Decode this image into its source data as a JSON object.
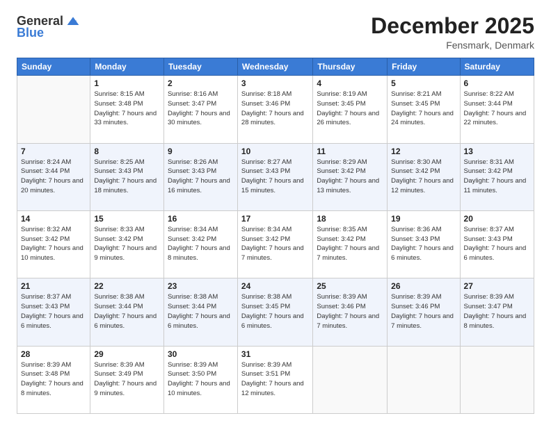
{
  "logo": {
    "general": "General",
    "blue": "Blue"
  },
  "header": {
    "month": "December 2025",
    "location": "Fensmark, Denmark"
  },
  "weekdays": [
    "Sunday",
    "Monday",
    "Tuesday",
    "Wednesday",
    "Thursday",
    "Friday",
    "Saturday"
  ],
  "weeks": [
    [
      {
        "day": "",
        "sunrise": "",
        "sunset": "",
        "daylight": ""
      },
      {
        "day": "1",
        "sunrise": "Sunrise: 8:15 AM",
        "sunset": "Sunset: 3:48 PM",
        "daylight": "Daylight: 7 hours and 33 minutes."
      },
      {
        "day": "2",
        "sunrise": "Sunrise: 8:16 AM",
        "sunset": "Sunset: 3:47 PM",
        "daylight": "Daylight: 7 hours and 30 minutes."
      },
      {
        "day": "3",
        "sunrise": "Sunrise: 8:18 AM",
        "sunset": "Sunset: 3:46 PM",
        "daylight": "Daylight: 7 hours and 28 minutes."
      },
      {
        "day": "4",
        "sunrise": "Sunrise: 8:19 AM",
        "sunset": "Sunset: 3:45 PM",
        "daylight": "Daylight: 7 hours and 26 minutes."
      },
      {
        "day": "5",
        "sunrise": "Sunrise: 8:21 AM",
        "sunset": "Sunset: 3:45 PM",
        "daylight": "Daylight: 7 hours and 24 minutes."
      },
      {
        "day": "6",
        "sunrise": "Sunrise: 8:22 AM",
        "sunset": "Sunset: 3:44 PM",
        "daylight": "Daylight: 7 hours and 22 minutes."
      }
    ],
    [
      {
        "day": "7",
        "sunrise": "Sunrise: 8:24 AM",
        "sunset": "Sunset: 3:44 PM",
        "daylight": "Daylight: 7 hours and 20 minutes."
      },
      {
        "day": "8",
        "sunrise": "Sunrise: 8:25 AM",
        "sunset": "Sunset: 3:43 PM",
        "daylight": "Daylight: 7 hours and 18 minutes."
      },
      {
        "day": "9",
        "sunrise": "Sunrise: 8:26 AM",
        "sunset": "Sunset: 3:43 PM",
        "daylight": "Daylight: 7 hours and 16 minutes."
      },
      {
        "day": "10",
        "sunrise": "Sunrise: 8:27 AM",
        "sunset": "Sunset: 3:43 PM",
        "daylight": "Daylight: 7 hours and 15 minutes."
      },
      {
        "day": "11",
        "sunrise": "Sunrise: 8:29 AM",
        "sunset": "Sunset: 3:42 PM",
        "daylight": "Daylight: 7 hours and 13 minutes."
      },
      {
        "day": "12",
        "sunrise": "Sunrise: 8:30 AM",
        "sunset": "Sunset: 3:42 PM",
        "daylight": "Daylight: 7 hours and 12 minutes."
      },
      {
        "day": "13",
        "sunrise": "Sunrise: 8:31 AM",
        "sunset": "Sunset: 3:42 PM",
        "daylight": "Daylight: 7 hours and 11 minutes."
      }
    ],
    [
      {
        "day": "14",
        "sunrise": "Sunrise: 8:32 AM",
        "sunset": "Sunset: 3:42 PM",
        "daylight": "Daylight: 7 hours and 10 minutes."
      },
      {
        "day": "15",
        "sunrise": "Sunrise: 8:33 AM",
        "sunset": "Sunset: 3:42 PM",
        "daylight": "Daylight: 7 hours and 9 minutes."
      },
      {
        "day": "16",
        "sunrise": "Sunrise: 8:34 AM",
        "sunset": "Sunset: 3:42 PM",
        "daylight": "Daylight: 7 hours and 8 minutes."
      },
      {
        "day": "17",
        "sunrise": "Sunrise: 8:34 AM",
        "sunset": "Sunset: 3:42 PM",
        "daylight": "Daylight: 7 hours and 7 minutes."
      },
      {
        "day": "18",
        "sunrise": "Sunrise: 8:35 AM",
        "sunset": "Sunset: 3:42 PM",
        "daylight": "Daylight: 7 hours and 7 minutes."
      },
      {
        "day": "19",
        "sunrise": "Sunrise: 8:36 AM",
        "sunset": "Sunset: 3:43 PM",
        "daylight": "Daylight: 7 hours and 6 minutes."
      },
      {
        "day": "20",
        "sunrise": "Sunrise: 8:37 AM",
        "sunset": "Sunset: 3:43 PM",
        "daylight": "Daylight: 7 hours and 6 minutes."
      }
    ],
    [
      {
        "day": "21",
        "sunrise": "Sunrise: 8:37 AM",
        "sunset": "Sunset: 3:43 PM",
        "daylight": "Daylight: 7 hours and 6 minutes."
      },
      {
        "day": "22",
        "sunrise": "Sunrise: 8:38 AM",
        "sunset": "Sunset: 3:44 PM",
        "daylight": "Daylight: 7 hours and 6 minutes."
      },
      {
        "day": "23",
        "sunrise": "Sunrise: 8:38 AM",
        "sunset": "Sunset: 3:44 PM",
        "daylight": "Daylight: 7 hours and 6 minutes."
      },
      {
        "day": "24",
        "sunrise": "Sunrise: 8:38 AM",
        "sunset": "Sunset: 3:45 PM",
        "daylight": "Daylight: 7 hours and 6 minutes."
      },
      {
        "day": "25",
        "sunrise": "Sunrise: 8:39 AM",
        "sunset": "Sunset: 3:46 PM",
        "daylight": "Daylight: 7 hours and 7 minutes."
      },
      {
        "day": "26",
        "sunrise": "Sunrise: 8:39 AM",
        "sunset": "Sunset: 3:46 PM",
        "daylight": "Daylight: 7 hours and 7 minutes."
      },
      {
        "day": "27",
        "sunrise": "Sunrise: 8:39 AM",
        "sunset": "Sunset: 3:47 PM",
        "daylight": "Daylight: 7 hours and 8 minutes."
      }
    ],
    [
      {
        "day": "28",
        "sunrise": "Sunrise: 8:39 AM",
        "sunset": "Sunset: 3:48 PM",
        "daylight": "Daylight: 7 hours and 8 minutes."
      },
      {
        "day": "29",
        "sunrise": "Sunrise: 8:39 AM",
        "sunset": "Sunset: 3:49 PM",
        "daylight": "Daylight: 7 hours and 9 minutes."
      },
      {
        "day": "30",
        "sunrise": "Sunrise: 8:39 AM",
        "sunset": "Sunset: 3:50 PM",
        "daylight": "Daylight: 7 hours and 10 minutes."
      },
      {
        "day": "31",
        "sunrise": "Sunrise: 8:39 AM",
        "sunset": "Sunset: 3:51 PM",
        "daylight": "Daylight: 7 hours and 12 minutes."
      },
      {
        "day": "",
        "sunrise": "",
        "sunset": "",
        "daylight": ""
      },
      {
        "day": "",
        "sunrise": "",
        "sunset": "",
        "daylight": ""
      },
      {
        "day": "",
        "sunrise": "",
        "sunset": "",
        "daylight": ""
      }
    ]
  ]
}
